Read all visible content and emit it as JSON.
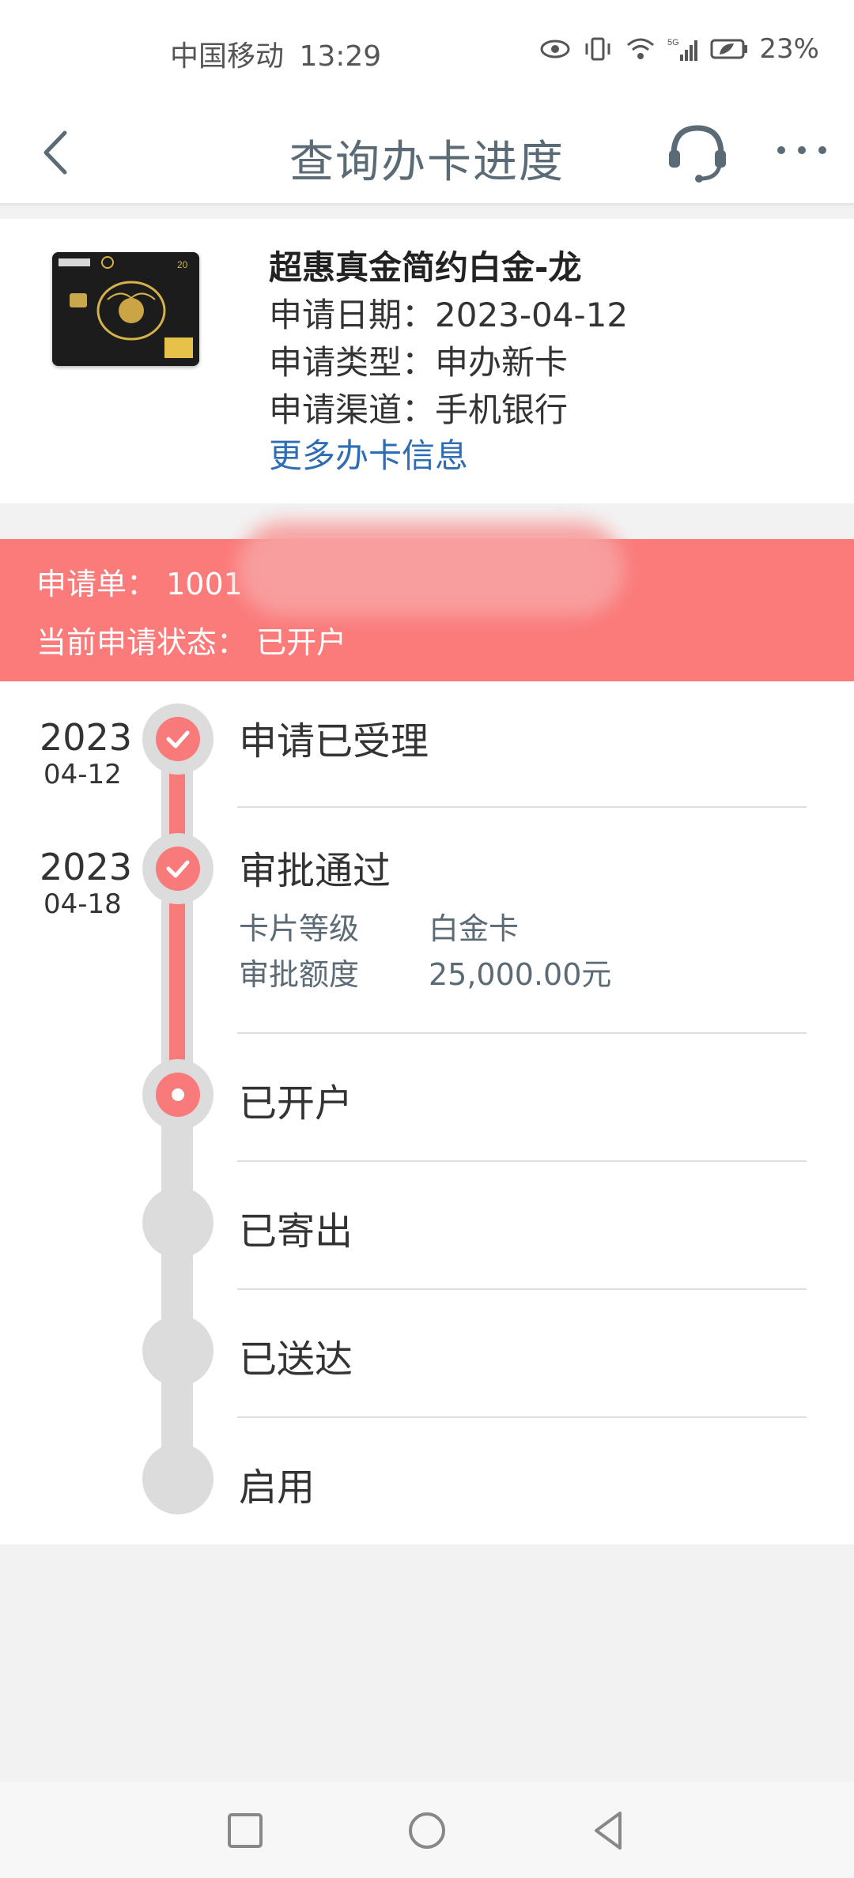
{
  "status_bar": {
    "carrier": "中国移动",
    "time": "13:29",
    "battery": "23%",
    "icons": [
      "eye-icon",
      "vibrate-icon",
      "wifi-icon",
      "5g-signal-icon",
      "battery-icon"
    ]
  },
  "nav": {
    "title": "查询办卡进度",
    "icons": [
      "back-arrow-icon",
      "headset-icon",
      "more-icon"
    ]
  },
  "card": {
    "name": "超惠真金简约白金-龙",
    "apply_date_label": "申请日期：",
    "apply_date": "2023-04-12",
    "apply_type_label": "申请类型：",
    "apply_type": "申办新卡",
    "channel_label": "申请渠道：",
    "channel": "手机银行",
    "more_link": "更多办卡信息"
  },
  "banner": {
    "order_label": "申请单：",
    "order_number": "1001",
    "status_label": "当前申请状态：",
    "status_value": "已开户"
  },
  "timeline": {
    "steps": [
      {
        "year": "2023",
        "md": "04-12",
        "title": "申请已受理",
        "state": "done"
      },
      {
        "year": "2023",
        "md": "04-18",
        "title": "审批通过",
        "state": "done",
        "details": [
          {
            "label": "卡片等级",
            "value": "白金卡"
          },
          {
            "label": "审批额度",
            "value": "25,000.00元"
          }
        ]
      },
      {
        "title": "已开户",
        "state": "current"
      },
      {
        "title": "已寄出",
        "state": "pending"
      },
      {
        "title": "已送达",
        "state": "pending"
      },
      {
        "title": "启用",
        "state": "pending"
      }
    ]
  },
  "colors": {
    "accent": "#f97a7a",
    "link": "#2e6db4",
    "title": "#5b6b76"
  },
  "system_nav": [
    "recent-apps-icon",
    "home-icon",
    "back-icon"
  ]
}
